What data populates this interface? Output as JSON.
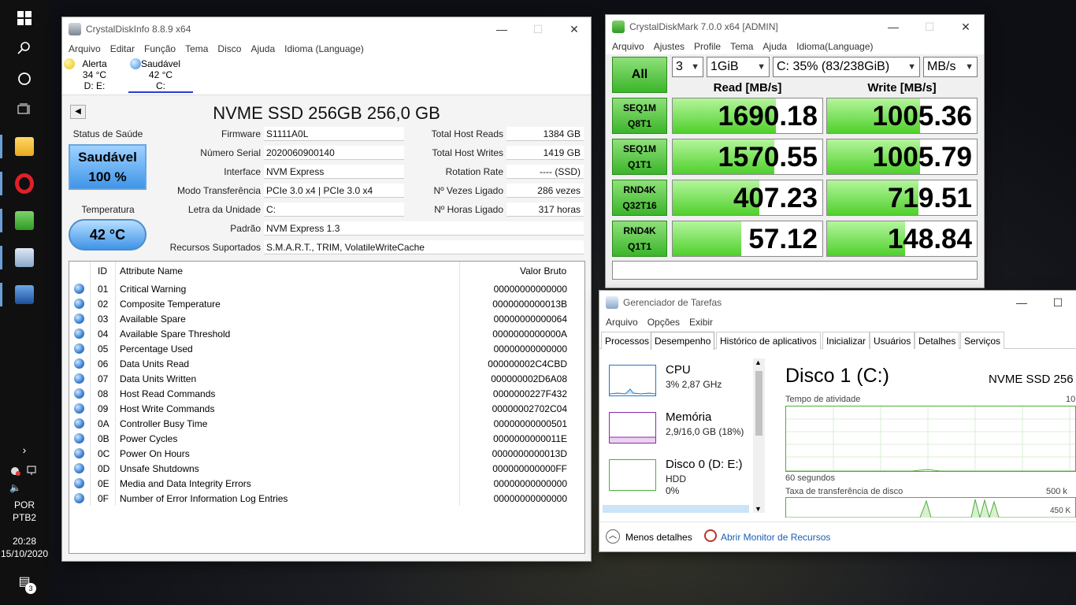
{
  "taskbar": {
    "time": "20:28",
    "date": "15/10/2020",
    "lang1": "POR",
    "lang2": "PTB2",
    "notif_count": "3"
  },
  "cdi": {
    "title": "CrystalDiskInfo 8.8.9 x64",
    "menu": [
      "Arquivo",
      "Editar",
      "Função",
      "Tema",
      "Disco",
      "Ajuda",
      "Idioma (Language)"
    ],
    "disks": [
      {
        "status": "Alerta",
        "temp": "34 °C",
        "letter": "D: E:",
        "color": "#f4d21f"
      },
      {
        "status": "Saudável",
        "temp": "42 °C",
        "letter": "C:",
        "color": "#4a9de6"
      }
    ],
    "disk_title": "NVME SSD 256GB 256,0 GB",
    "health_label": "Status de Saúde",
    "health_status": "Saudável",
    "health_pct": "100 %",
    "temp_label": "Temperatura",
    "temp_value": "42 °C",
    "fields": {
      "firmware_l": "Firmware",
      "firmware": "S1111A0L",
      "serial_l": "Número Serial",
      "serial": "2020060900140",
      "interface_l": "Interface",
      "interface": "NVM Express",
      "transfer_l": "Modo Transferência",
      "transfer": "PCIe 3.0 x4 | PCIe 3.0 x4",
      "letter_l": "Letra da Unidade",
      "letter": "C:",
      "standard_l": "Padrão",
      "standard": "NVM Express 1.3",
      "features_l": "Recursos Suportados",
      "features": "S.M.A.R.T., TRIM, VolatileWriteCache",
      "reads_l": "Total Host Reads",
      "reads": "1384 GB",
      "writes_l": "Total Host Writes",
      "writes": "1419 GB",
      "rotation_l": "Rotation Rate",
      "rotation": "---- (SSD)",
      "powercount_l": "Nº Vezes Ligado",
      "powercount": "286 vezes",
      "powerhours_l": "Nº Horas Ligado",
      "powerhours": "317 horas"
    },
    "table_headers": {
      "id": "ID",
      "name": "Attribute Name",
      "raw": "Valor Bruto"
    },
    "attributes": [
      {
        "id": "01",
        "name": "Critical Warning",
        "raw": "00000000000000"
      },
      {
        "id": "02",
        "name": "Composite Temperature",
        "raw": "0000000000013B"
      },
      {
        "id": "03",
        "name": "Available Spare",
        "raw": "00000000000064"
      },
      {
        "id": "04",
        "name": "Available Spare Threshold",
        "raw": "0000000000000A"
      },
      {
        "id": "05",
        "name": "Percentage Used",
        "raw": "00000000000000"
      },
      {
        "id": "06",
        "name": "Data Units Read",
        "raw": "000000002C4CBD"
      },
      {
        "id": "07",
        "name": "Data Units Written",
        "raw": "000000002D6A08"
      },
      {
        "id": "08",
        "name": "Host Read Commands",
        "raw": "0000000227F432"
      },
      {
        "id": "09",
        "name": "Host Write Commands",
        "raw": "00000002702C04"
      },
      {
        "id": "0A",
        "name": "Controller Busy Time",
        "raw": "00000000000501"
      },
      {
        "id": "0B",
        "name": "Power Cycles",
        "raw": "0000000000011E"
      },
      {
        "id": "0C",
        "name": "Power On Hours",
        "raw": "0000000000013D"
      },
      {
        "id": "0D",
        "name": "Unsafe Shutdowns",
        "raw": "000000000000FF"
      },
      {
        "id": "0E",
        "name": "Media and Data Integrity Errors",
        "raw": "00000000000000"
      },
      {
        "id": "0F",
        "name": "Number of Error Information Log Entries",
        "raw": "00000000000000"
      }
    ]
  },
  "cdm": {
    "title": "CrystalDiskMark 7.0.0 x64 [ADMIN]",
    "menu": [
      "Arquivo",
      "Ajustes",
      "Profile",
      "Tema",
      "Ajuda",
      "Idioma(Language)"
    ],
    "all_label": "All",
    "count": "3",
    "size": "1GiB",
    "drive": "C: 35% (83/238GiB)",
    "unit": "MB/s",
    "read_header": "Read [MB/s]",
    "write_header": "Write [MB/s]",
    "tests": [
      {
        "l1": "SEQ1M",
        "l2": "Q8T1",
        "read": "1690.18",
        "write": "1005.36",
        "read_fill": 0.69,
        "write_fill": 0.62
      },
      {
        "l1": "SEQ1M",
        "l2": "Q1T1",
        "read": "1570.55",
        "write": "1005.79",
        "read_fill": 0.68,
        "write_fill": 0.62
      },
      {
        "l1": "RND4K",
        "l2": "Q32T16",
        "read": "407.23",
        "write": "719.51",
        "read_fill": 0.58,
        "write_fill": 0.61
      },
      {
        "l1": "RND4K",
        "l2": "Q1T1",
        "read": "57.12",
        "write": "148.84",
        "read_fill": 0.46,
        "write_fill": 0.52
      }
    ]
  },
  "tm": {
    "title": "Gerenciador de Tarefas",
    "menu": [
      "Arquivo",
      "Opções",
      "Exibir"
    ],
    "tabs": [
      "Processos",
      "Desempenho",
      "Histórico de aplicativos",
      "Inicializar",
      "Usuários",
      "Detalhes",
      "Serviços"
    ],
    "items": [
      {
        "name": "CPU",
        "sub1": "3% 2,87 GHz",
        "sub2": "",
        "color": "#1f77c9"
      },
      {
        "name": "Memória",
        "sub1": "2,9/16,0 GB (18%)",
        "sub2": "",
        "color": "#8b2aa8"
      },
      {
        "name": "Disco 0 (D: E:)",
        "sub1": "HDD",
        "sub2": "0%",
        "color": "#4fae3a"
      }
    ],
    "disk_heading": "Disco 1 (C:)",
    "disk_model": "NVME SSD 256",
    "activity_label": "Tempo de atividade",
    "activity_max": "10",
    "seconds_label": "60 segundos",
    "transfer_label": "Taxa de transferência de disco",
    "transfer_max": "500 k",
    "transfer_mid": "450 K",
    "less_details": "Menos detalhes",
    "resource_monitor": "Abrir Monitor de Recursos"
  }
}
